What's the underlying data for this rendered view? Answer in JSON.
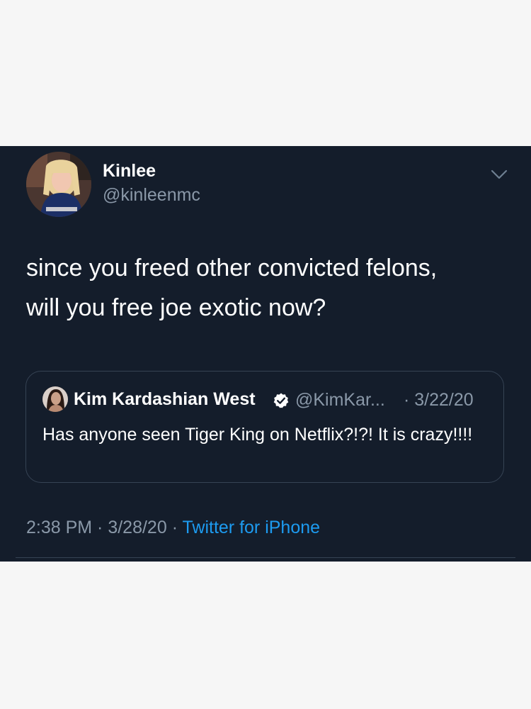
{
  "tweet": {
    "author": {
      "name": "Kinlee",
      "handle": "@kinleenmc",
      "avatar_icon": "profile-photo"
    },
    "menu_icon": "chevron-down-icon",
    "text_line1": "since you freed other convicted felons,",
    "text_line2": "will you free joe exotic now?",
    "quoted_tweet": {
      "author_name": "Kim Kardashian West",
      "verified": true,
      "verified_icon": "verified-badge-icon",
      "handle": "@KimKar...",
      "date": "· 3/22/20",
      "text": "Has anyone seen Tiger King on Netflix?!?! It is crazy!!!!"
    },
    "time": "2:38 PM",
    "separator1": " · ",
    "date": "3/28/20",
    "separator2": " · ",
    "source": "Twitter for iPhone"
  },
  "colors": {
    "page_background": "#f6f6f6",
    "card_background": "#141d2b",
    "primary_text": "#ffffff",
    "secondary_text": "#8a98a8",
    "link": "#1d9bf0",
    "border": "#364354"
  }
}
